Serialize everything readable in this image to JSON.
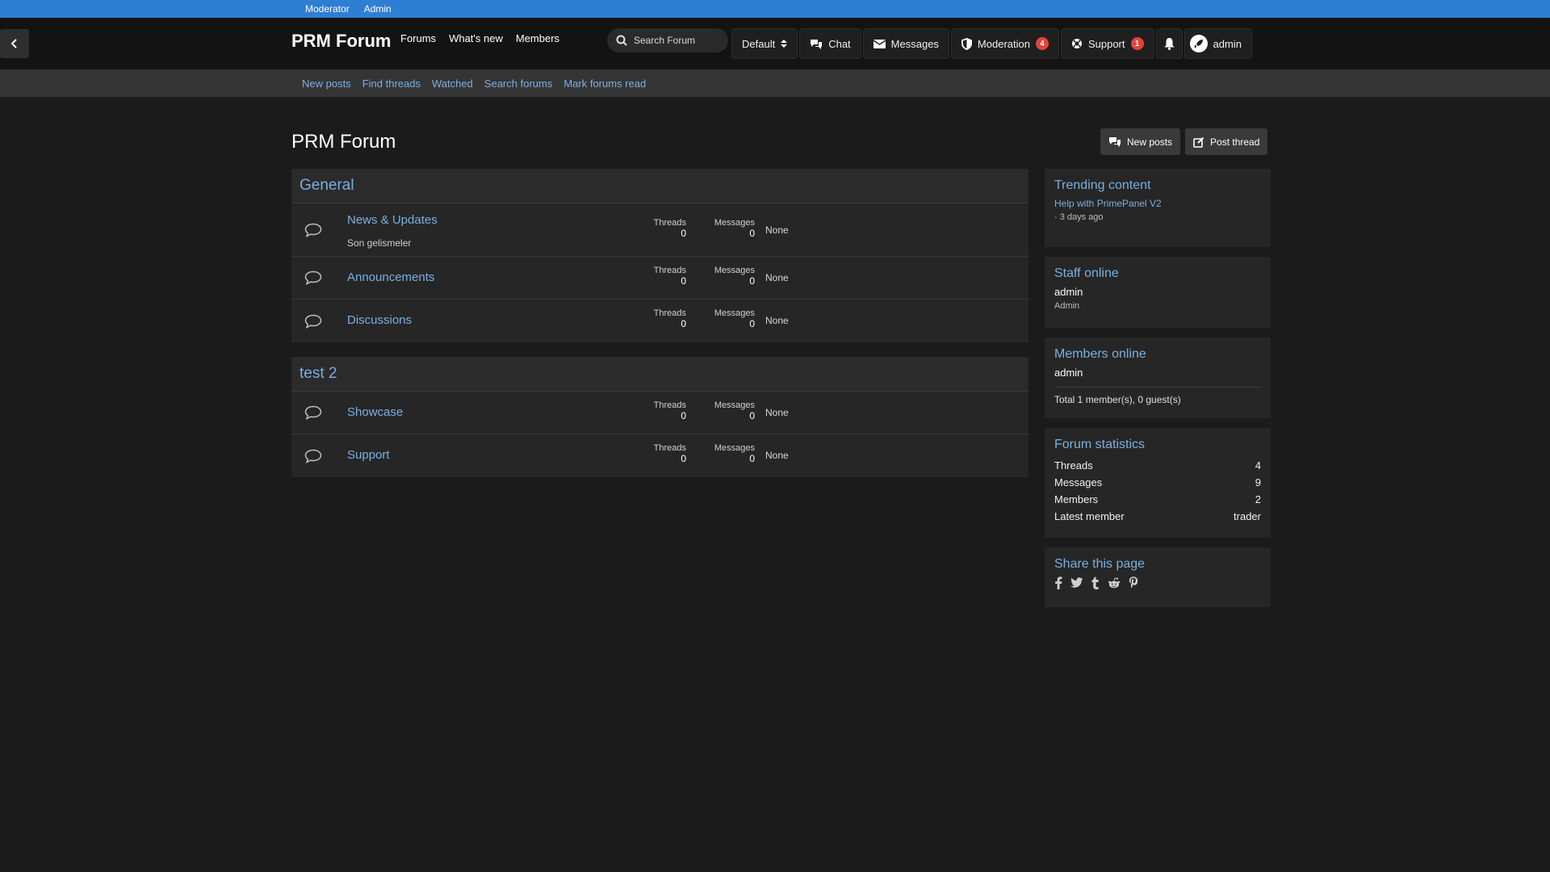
{
  "staffbar": {
    "moderator": "Moderator",
    "admin": "Admin"
  },
  "header": {
    "site_title": "PRM Forum",
    "nav": {
      "forums": "Forums",
      "whats_new": "What's new",
      "members": "Members"
    },
    "search_placeholder": "Search Forum",
    "style_chooser": "Default",
    "chat": "Chat",
    "messages": "Messages",
    "moderation": "Moderation",
    "moderation_count": "4",
    "support": "Support",
    "support_count": "1",
    "user": "admin"
  },
  "subnav": {
    "new_posts": "New posts",
    "find_threads": "Find threads",
    "watched": "Watched",
    "search_forums": "Search forums",
    "mark_read": "Mark forums read"
  },
  "page": {
    "title": "PRM Forum",
    "new_posts_btn": "New posts",
    "post_thread_btn": "Post thread"
  },
  "labels": {
    "threads": "Threads",
    "messages": "Messages"
  },
  "categories": [
    {
      "name": "General",
      "nodes": [
        {
          "title": "News & Updates",
          "desc": "Son gelismeler",
          "threads": "0",
          "messages": "0",
          "last": "None"
        },
        {
          "title": "Announcements",
          "threads": "0",
          "messages": "0",
          "last": "None"
        },
        {
          "title": "Discussions",
          "threads": "0",
          "messages": "0",
          "last": "None"
        }
      ]
    },
    {
      "name": "test 2",
      "nodes": [
        {
          "title": "Showcase",
          "threads": "0",
          "messages": "0",
          "last": "None"
        },
        {
          "title": "Support",
          "threads": "0",
          "messages": "0",
          "last": "None"
        }
      ]
    }
  ],
  "sidebar": {
    "trending": {
      "title": "Trending content",
      "item": "Help with PrimePanel V2",
      "meta": "· 3 days ago"
    },
    "staff": {
      "title": "Staff online",
      "name": "admin",
      "role": "Admin"
    },
    "members": {
      "title": "Members online",
      "name": "admin",
      "total": "Total 1 member(s), 0 guest(s)"
    },
    "stats": {
      "title": "Forum statistics",
      "rows": [
        {
          "label": "Threads",
          "value": "4"
        },
        {
          "label": "Messages",
          "value": "9"
        },
        {
          "label": "Members",
          "value": "2"
        },
        {
          "label": "Latest member",
          "value": "trader"
        }
      ]
    },
    "share": {
      "title": "Share this page",
      "icons": [
        "facebook-icon",
        "twitter-icon",
        "tumblr-icon",
        "reddit-icon",
        "pinterest-icon"
      ]
    }
  }
}
